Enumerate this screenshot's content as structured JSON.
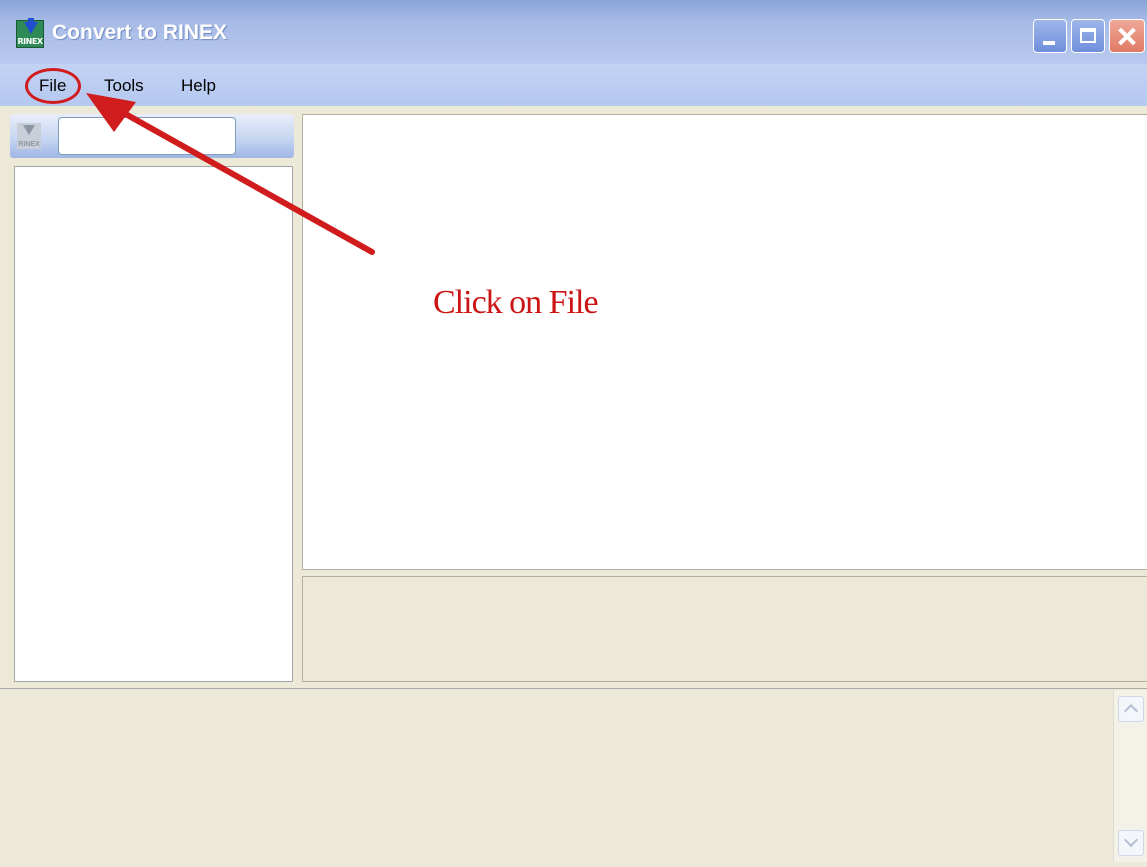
{
  "window": {
    "title": "Convert to RINEX",
    "icon": "rinex-convert-icon",
    "icon_label": "RINEX"
  },
  "menu": {
    "file": "File",
    "tools": "Tools",
    "help": "Help"
  },
  "left_panel": {
    "toolbar_icon": "rinex-icon",
    "toolbar_icon_label": "RINEX",
    "input_value": ""
  },
  "annotation": {
    "text": "Click on File",
    "color": "#cc1414"
  },
  "colors": {
    "titlebar": "#8aa4d8",
    "menubar": "#b5c8ef",
    "panel_bg": "#ece9d8",
    "close_button": "#e07a66"
  }
}
